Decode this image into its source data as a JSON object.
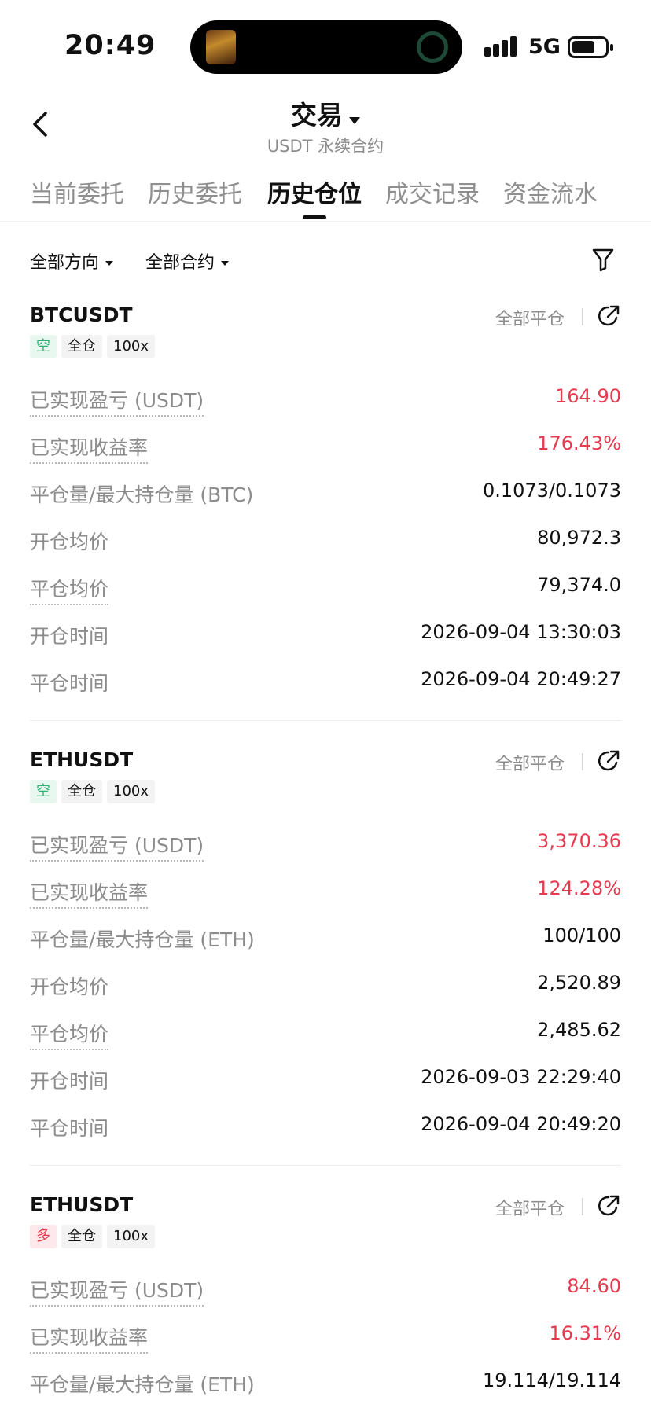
{
  "status_bar": {
    "time": "20:49",
    "network": "5G"
  },
  "header": {
    "title": "交易",
    "subtitle": "USDT 永续合约"
  },
  "tabs": [
    {
      "label": "当前委托",
      "active": false
    },
    {
      "label": "历史委托",
      "active": false
    },
    {
      "label": "历史仓位",
      "active": true
    },
    {
      "label": "成交记录",
      "active": false
    },
    {
      "label": "资金流水",
      "active": false
    }
  ],
  "filters": {
    "direction": "全部方向",
    "contract": "全部合约"
  },
  "colors": {
    "red": "#e8394f",
    "green": "#29b673",
    "gray": "#8c8c8c"
  },
  "positions": [
    {
      "symbol": "BTCUSDT",
      "close_all": "全部平仓",
      "tags": [
        "空",
        "全仓",
        "100x"
      ],
      "side": "short",
      "rows": [
        {
          "label": "已实现盈亏 (USDT)",
          "value": "164.90"
        },
        {
          "label": "已实现收益率",
          "value": "176.43%"
        },
        {
          "label": "平仓量/最大持仓量 (BTC)",
          "value": "0.1073/0.1073"
        },
        {
          "label": "开仓均价",
          "value": "80,972.3"
        },
        {
          "label": "平仓均价",
          "value": "79,374.0"
        },
        {
          "label": "开仓时间",
          "value": "2026-09-04 13:30:03"
        },
        {
          "label": "平仓时间",
          "value": "2026-09-04 20:49:27"
        }
      ]
    },
    {
      "symbol": "ETHUSDT",
      "close_all": "全部平仓",
      "tags": [
        "空",
        "全仓",
        "100x"
      ],
      "side": "short",
      "rows": [
        {
          "label": "已实现盈亏 (USDT)",
          "value": "3,370.36"
        },
        {
          "label": "已实现收益率",
          "value": "124.28%"
        },
        {
          "label": "平仓量/最大持仓量 (ETH)",
          "value": "100/100"
        },
        {
          "label": "开仓均价",
          "value": "2,520.89"
        },
        {
          "label": "平仓均价",
          "value": "2,485.62"
        },
        {
          "label": "开仓时间",
          "value": "2026-09-03 22:29:40"
        },
        {
          "label": "平仓时间",
          "value": "2026-09-04 20:49:20"
        }
      ]
    },
    {
      "symbol": "ETHUSDT",
      "close_all": "全部平仓",
      "tags": [
        "多",
        "全仓",
        "100x"
      ],
      "side": "long",
      "rows": [
        {
          "label": "已实现盈亏 (USDT)",
          "value": "84.60"
        },
        {
          "label": "已实现收益率",
          "value": "16.31%"
        },
        {
          "label": "平仓量/最大持仓量 (ETH)",
          "value": "19.114/19.114"
        }
      ]
    }
  ]
}
